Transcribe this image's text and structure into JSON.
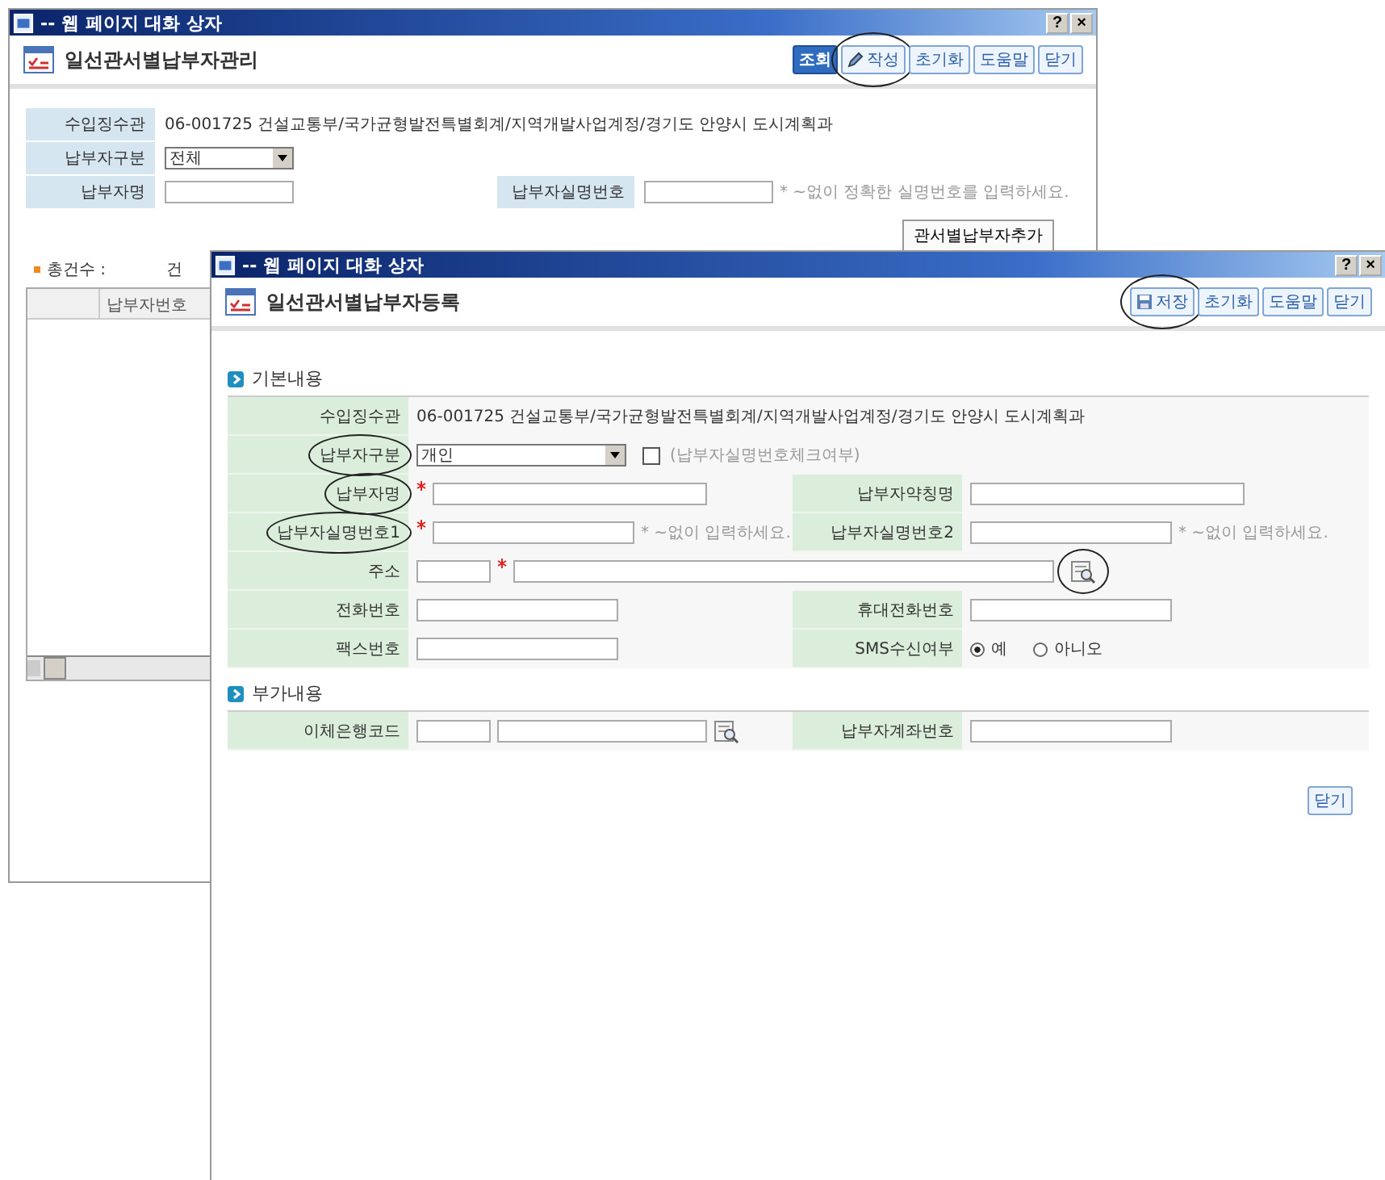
{
  "back_window": {
    "title_bar": "-- 웹 페이지 대화 상자",
    "help": "?",
    "close": "×",
    "title": "일선관서별납부자관리",
    "buttons": [
      {
        "label": "조회",
        "kind": "primary",
        "circled": false
      },
      {
        "label": "작성",
        "kind": "pencil",
        "circled": true
      },
      {
        "label": "초기화",
        "kind": "plain",
        "circled": false
      },
      {
        "label": "도움말",
        "kind": "plain",
        "circled": false
      },
      {
        "label": "닫기",
        "kind": "plain",
        "circled": false
      }
    ],
    "rows": [
      [
        {
          "label": "수입징수관",
          "kind": "text",
          "value": "06-001725 건설교통부/국가균형발전특별회계/지역개발사업계정/경기도 안양시 도시계획과"
        }
      ],
      [
        {
          "label": "납부자구분",
          "kind": "select",
          "value": "전체"
        }
      ],
      [
        {
          "label": "납부자명",
          "kind": "input"
        },
        {
          "label": "납부자실명번호",
          "kind": "input",
          "hint": "* ~없이 정확한 실명번호를 입력하세요."
        }
      ]
    ],
    "add_button": "관서별납부자추가",
    "total_label": "총건수 :",
    "total_unit": "건",
    "grid_column": "납부자번호"
  },
  "front_window": {
    "title_bar": "-- 웹 페이지 대화 상자",
    "help": "?",
    "close": "×",
    "title": "일선관서별납부자등록",
    "buttons": [
      {
        "label": "저장",
        "kind": "disk",
        "circled": true
      },
      {
        "label": "초기화",
        "kind": "plain",
        "circled": false
      },
      {
        "label": "도움말",
        "kind": "plain",
        "circled": false
      },
      {
        "label": "닫기",
        "kind": "plain",
        "circled": false
      }
    ],
    "sections": [
      {
        "title": "기본내용",
        "rows": [
          [
            {
              "label": "수입징수관",
              "kind": "text",
              "circled": false,
              "value": "06-001725 건설교통부/국가균형발전특별회계/지역개발사업계정/경기도 안양시 도시계획과"
            }
          ],
          [
            {
              "label": "납부자구분",
              "kind": "select",
              "circled": true,
              "value": "개인",
              "checkbox": {
                "label": "(납부자실명번호체크여부)",
                "checked": false
              }
            }
          ],
          [
            {
              "label": "납부자명",
              "kind": "input",
              "circled": true,
              "required": true,
              "wide": true
            },
            {
              "label": "납부자약칭명",
              "kind": "input",
              "circled": false,
              "wide": true
            }
          ],
          [
            {
              "label": "납부자실명번호1",
              "kind": "input",
              "circled": true,
              "required": true,
              "hint": "* ~없이 입력하세요."
            },
            {
              "label": "납부자실명번호2",
              "kind": "input",
              "circled": false,
              "hint": "* ~없이 입력하세요."
            }
          ],
          [
            {
              "label": "주소",
              "kind": "address",
              "circled": false,
              "required": true,
              "icon_circled": true
            }
          ],
          [
            {
              "label": "전화번호",
              "kind": "input",
              "circled": false
            },
            {
              "label": "휴대전화번호",
              "kind": "input",
              "circled": false
            }
          ],
          [
            {
              "label": "팩스번호",
              "kind": "input",
              "circled": false
            },
            {
              "label": "SMS수신여부",
              "kind": "radio",
              "circled": false,
              "options": [
                {
                  "label": "예",
                  "selected": true
                },
                {
                  "label": "아니오",
                  "selected": false
                }
              ]
            }
          ]
        ]
      },
      {
        "title": "부가내용",
        "rows": [
          [
            {
              "label": "이체은행코드",
              "kind": "bank",
              "circled": false
            },
            {
              "label": "납부자계좌번호",
              "kind": "input",
              "circled": false
            }
          ]
        ]
      }
    ],
    "footer_button": "닫기"
  }
}
